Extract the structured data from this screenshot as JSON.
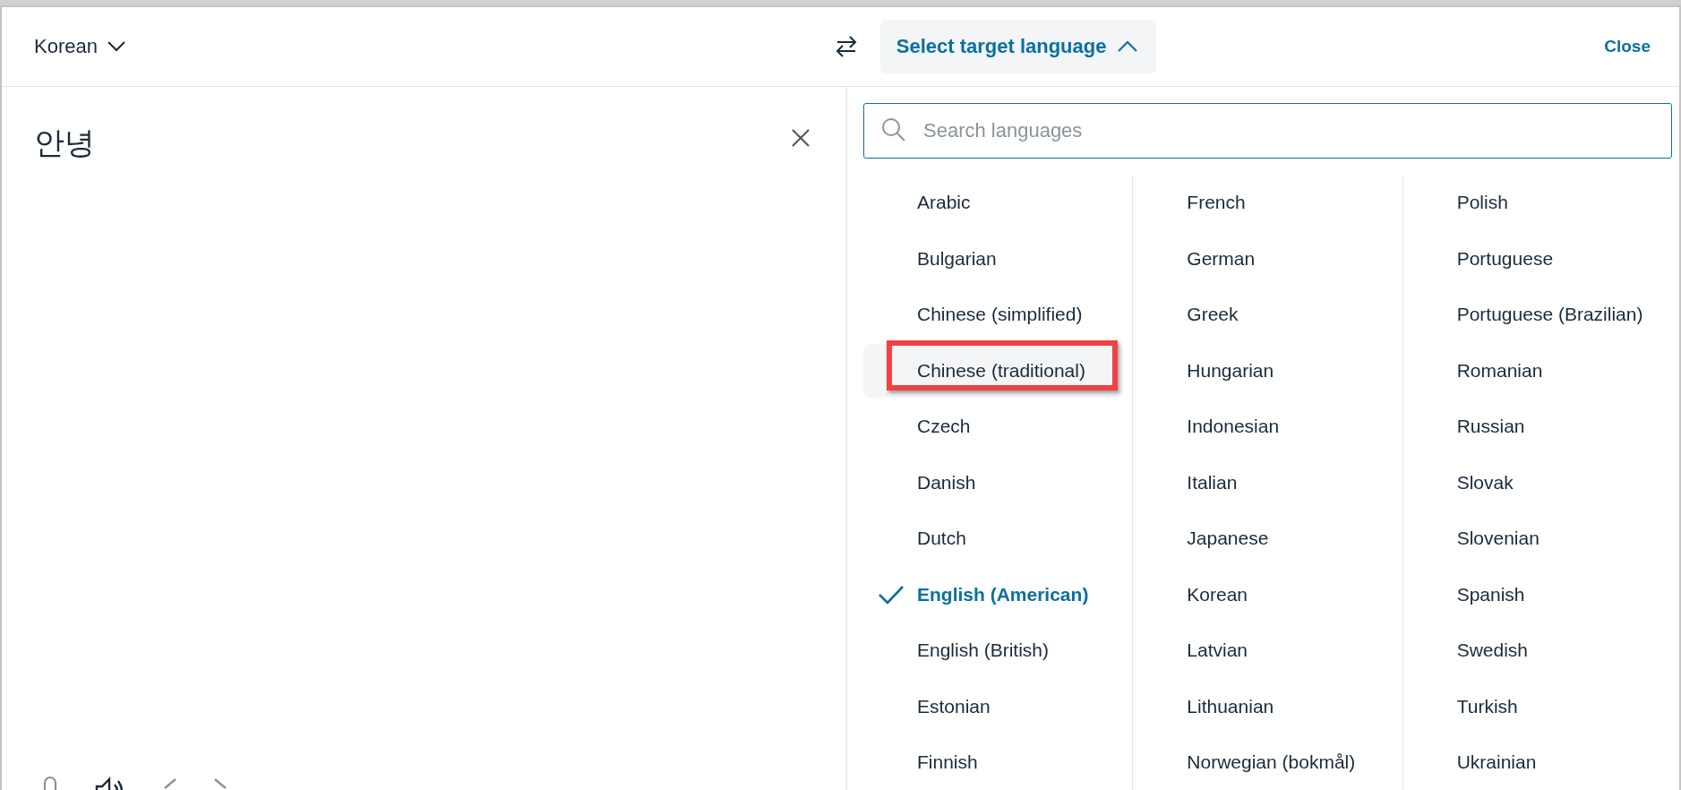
{
  "header": {
    "source_language": "Korean",
    "target_button": "Select target language",
    "close": "Close"
  },
  "source": {
    "text": "안녕"
  },
  "search": {
    "placeholder": "Search languages"
  },
  "languages": [
    {
      "label": "Arabic",
      "selected": false,
      "highlighted": false
    },
    {
      "label": "Bulgarian",
      "selected": false,
      "highlighted": false
    },
    {
      "label": "Chinese (simplified)",
      "selected": false,
      "highlighted": false
    },
    {
      "label": "Chinese (traditional)",
      "selected": false,
      "highlighted": true
    },
    {
      "label": "Czech",
      "selected": false,
      "highlighted": false
    },
    {
      "label": "Danish",
      "selected": false,
      "highlighted": false
    },
    {
      "label": "Dutch",
      "selected": false,
      "highlighted": false
    },
    {
      "label": "English (American)",
      "selected": true,
      "highlighted": false
    },
    {
      "label": "English (British)",
      "selected": false,
      "highlighted": false
    },
    {
      "label": "Estonian",
      "selected": false,
      "highlighted": false
    },
    {
      "label": "Finnish",
      "selected": false,
      "highlighted": false
    },
    {
      "label": "French",
      "selected": false,
      "highlighted": false
    },
    {
      "label": "German",
      "selected": false,
      "highlighted": false
    },
    {
      "label": "Greek",
      "selected": false,
      "highlighted": false
    },
    {
      "label": "Hungarian",
      "selected": false,
      "highlighted": false
    },
    {
      "label": "Indonesian",
      "selected": false,
      "highlighted": false
    },
    {
      "label": "Italian",
      "selected": false,
      "highlighted": false
    },
    {
      "label": "Japanese",
      "selected": false,
      "highlighted": false
    },
    {
      "label": "Korean",
      "selected": false,
      "highlighted": false
    },
    {
      "label": "Latvian",
      "selected": false,
      "highlighted": false
    },
    {
      "label": "Lithuanian",
      "selected": false,
      "highlighted": false
    },
    {
      "label": "Norwegian (bokmål)",
      "selected": false,
      "highlighted": false
    },
    {
      "label": "Polish",
      "selected": false,
      "highlighted": false
    },
    {
      "label": "Portuguese",
      "selected": false,
      "highlighted": false
    },
    {
      "label": "Portuguese (Brazilian)",
      "selected": false,
      "highlighted": false
    },
    {
      "label": "Romanian",
      "selected": false,
      "highlighted": false
    },
    {
      "label": "Russian",
      "selected": false,
      "highlighted": false
    },
    {
      "label": "Slovak",
      "selected": false,
      "highlighted": false
    },
    {
      "label": "Slovenian",
      "selected": false,
      "highlighted": false
    },
    {
      "label": "Spanish",
      "selected": false,
      "highlighted": false
    },
    {
      "label": "Swedish",
      "selected": false,
      "highlighted": false
    },
    {
      "label": "Turkish",
      "selected": false,
      "highlighted": false
    },
    {
      "label": "Ukrainian",
      "selected": false,
      "highlighted": false
    }
  ]
}
